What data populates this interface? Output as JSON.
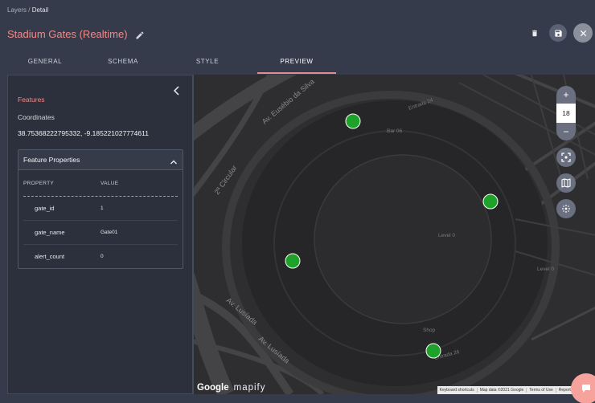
{
  "breadcrumb": {
    "root": "Layers",
    "separator": " / ",
    "current": "Detail"
  },
  "page": {
    "title": "Stadium Gates (Realtime)"
  },
  "tabs": [
    {
      "label": "GENERAL"
    },
    {
      "label": "SCHEMA"
    },
    {
      "label": "STYLE"
    },
    {
      "label": "PREVIEW"
    }
  ],
  "active_tab": "PREVIEW",
  "panel": {
    "features_label": "Features",
    "coordinates_label": "Coordinates",
    "coordinates_value": "38.75368222795332, -9.185221027774611",
    "feature_properties": {
      "title": "Feature Properties",
      "columns": {
        "property": "PROPERTY",
        "value": "VALUE"
      },
      "rows": [
        {
          "property": "gate_id",
          "value": "1"
        },
        {
          "property": "gate_name",
          "value": "Gate01"
        },
        {
          "property": "alert_count",
          "value": "0"
        }
      ]
    }
  },
  "map": {
    "zoom_in": "+",
    "zoom_level": "18",
    "zoom_out": "−",
    "brand_google": "Google",
    "brand_mapify": "mapify",
    "street_labels": [
      "Av. Eusébio da Silva",
      "Av. Lusíada",
      "Av. Lusíada",
      "2ª Circular",
      "Level 0",
      "Level 0",
      "Entrada 24",
      "Bar 06",
      "Shop",
      "Entrada 26"
    ],
    "attribution": [
      "Keyboard shortcuts",
      "Map data ©2021 Google",
      "Terms of Use",
      "Report a map error"
    ],
    "marker_color": "#1fa22a"
  },
  "colors": {
    "accent": "#f08a8a",
    "background": "#353b4b",
    "panel": "#2b303c"
  }
}
